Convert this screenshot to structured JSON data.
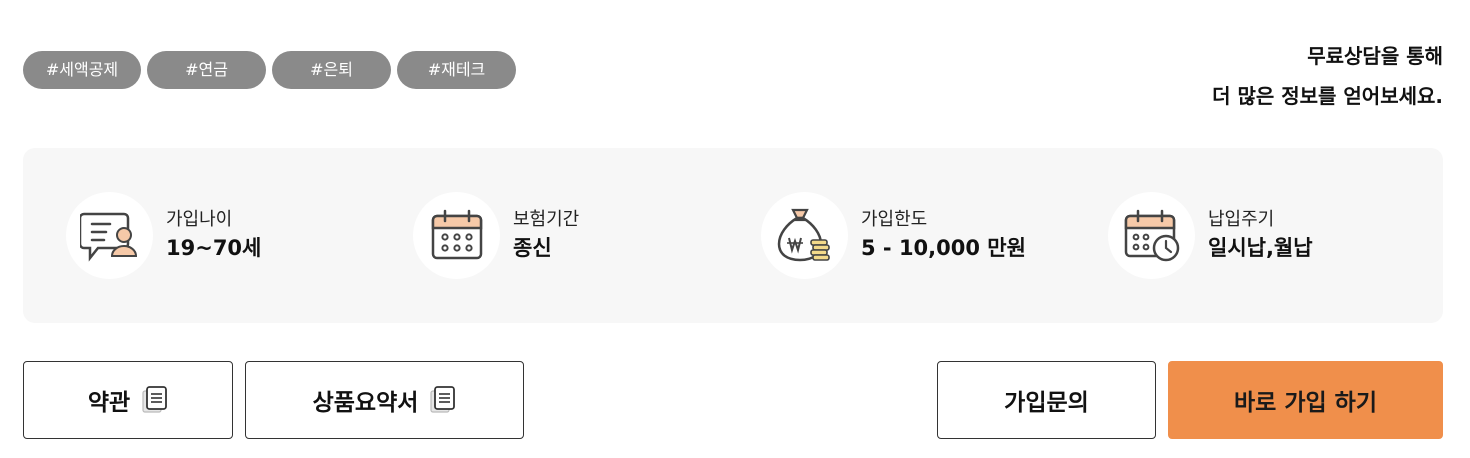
{
  "tags": [
    "#세액공제",
    "#연금",
    "#은퇴",
    "#재테크"
  ],
  "promo": {
    "line1": "무료상담을 통해",
    "line2": "더 많은 정보를 얻어보세요."
  },
  "info": [
    {
      "icon": "age-chat-person-icon",
      "label": "가입나이",
      "value": "19~70세"
    },
    {
      "icon": "calendar-icon",
      "label": "보험기간",
      "value": "종신"
    },
    {
      "icon": "money-bag-coins-icon",
      "label": "가입한도",
      "value": "5 - 10,000 만원"
    },
    {
      "icon": "calendar-clock-icon",
      "label": "납입주기",
      "value": "일시납,월납"
    }
  ],
  "buttons": {
    "terms": "약관",
    "summary": "상품요약서",
    "inquiry": "가입문의",
    "join": "바로 가입 하기"
  },
  "colors": {
    "accent": "#f08f4b",
    "tag_bg": "#8a8a8a",
    "panel_bg": "#f7f7f7"
  }
}
